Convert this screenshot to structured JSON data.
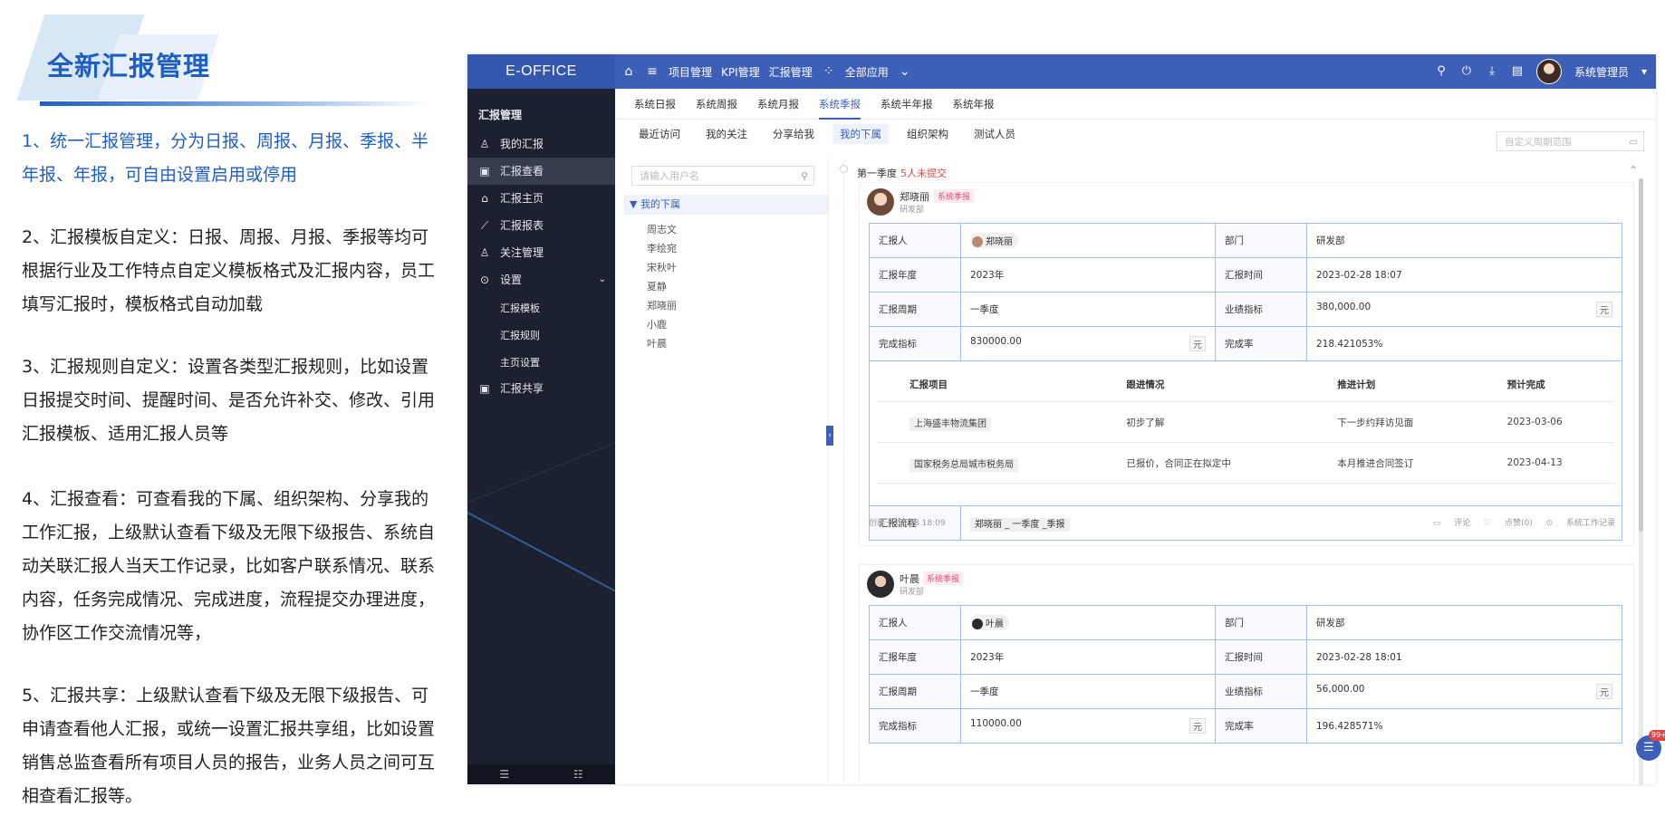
{
  "promo": {
    "title": "全新汇报管理",
    "paragraphs": [
      "1、统一汇报管理，分为日报、周报、月报、季报、半年报、年报，可自由设置启用或停用",
      "2、汇报模板自定义：日报、周报、月报、季报等均可根据行业及工作特点自定义模板格式及汇报内容，员工填写汇报时，模板格式自动加载",
      "3、汇报规则自定义：设置各类型汇报规则，比如设置日报提交时间、提醒时间、是否允许补交、修改、引用汇报模板、适用汇报人员等",
      "4、汇报查看：可查看我的下属、组织架构、分享我的工作汇报，上级默认查看下级及无限下级报告、系统自动关联汇报人当天工作记录，比如客户联系情况、联系内容，任务完成情况、完成进度，流程提交办理进度，协作区工作交流情况等，",
      "5、汇报共享：上级默认查看下级及无限下级报告、可申请查看他人汇报，或统一设置汇报共享组，比如设置销售总监查看所有项目人员的报告，业务人员之间可互相查看汇报等。"
    ]
  },
  "topbar": {
    "brand": "E-OFFICE",
    "nav": [
      "项目管理",
      "KPI管理",
      "汇报管理",
      "全部应用"
    ],
    "user": "系统管理员"
  },
  "sidebar": {
    "title": "汇报管理",
    "items": [
      "我的汇报",
      "汇报查看",
      "汇报主页",
      "汇报报表",
      "关注管理",
      "设置",
      "汇报共享"
    ],
    "sub_items": [
      "汇报模板",
      "汇报规则",
      "主页设置"
    ]
  },
  "tabs_primary": [
    "系统日报",
    "系统周报",
    "系统月报",
    "系统季报",
    "系统半年报",
    "系统年报"
  ],
  "tabs_secondary": [
    "最近访问",
    "我的关注",
    "分享给我",
    "我的下属",
    "组织架构",
    "测试人员"
  ],
  "range_placeholder": "自定义周期范围",
  "tree": {
    "search_placeholder": "请输入用户名",
    "root": "▼ 我的下属",
    "nodes": [
      "周志文",
      "李绘宛",
      "宋秋叶",
      "夏静",
      "郑晓丽",
      "小鹿",
      "叶晨"
    ]
  },
  "quarter": {
    "title": "第一季度",
    "pending": "5人未提交"
  },
  "card1": {
    "name": "郑晓丽",
    "dept": "研发部",
    "tag": "系统季报",
    "labels": {
      "reporter": "汇报人",
      "dept": "部门",
      "year": "汇报年度",
      "time": "汇报时间",
      "period": "汇报周期",
      "target": "业绩指标",
      "goal": "完成指标",
      "rate": "完成率",
      "flow": "汇报流程"
    },
    "reporter": "郑晓丽",
    "dept_value": "研发部",
    "year": "2023年",
    "time": "2023-02-28 18:07",
    "period": "一季度",
    "target": "380,000.00",
    "unit": "元",
    "goal": "830000.00",
    "rate": "218.421053%",
    "sub_headers": [
      "汇报项目",
      "跟进情况",
      "推进计划",
      "预计完成"
    ],
    "sub_rows": [
      [
        "上海盛丰物流集团",
        "初步了解",
        "下一步约拜访见面",
        "2023-03-06"
      ],
      [
        "国家税务总局城市税务局",
        "已报价，合同正在拟定中",
        "本月推进合同签订",
        "2023-04-13"
      ]
    ],
    "flow": "郑晓丽 _ 一季度 _季报",
    "created": "创建于 02/28 18:09",
    "actions": [
      "评论",
      "点赞(0)",
      "系统工作记录"
    ]
  },
  "card2": {
    "name": "叶晨",
    "dept": "研发部",
    "tag": "系统季报",
    "reporter": "叶晨",
    "dept_value": "研发部",
    "year": "2023年",
    "time": "2023-02-28 18:01",
    "period": "一季度",
    "target": "56,000.00",
    "unit": "元",
    "goal": "110000.00",
    "rate": "196.428571%"
  },
  "chat_badge": "99+",
  "colors": {
    "accent": "#3d5fb8",
    "sidebar": "#1c2130",
    "title_blue": "#1f5fc2",
    "tag_red": "#e04f7a"
  }
}
